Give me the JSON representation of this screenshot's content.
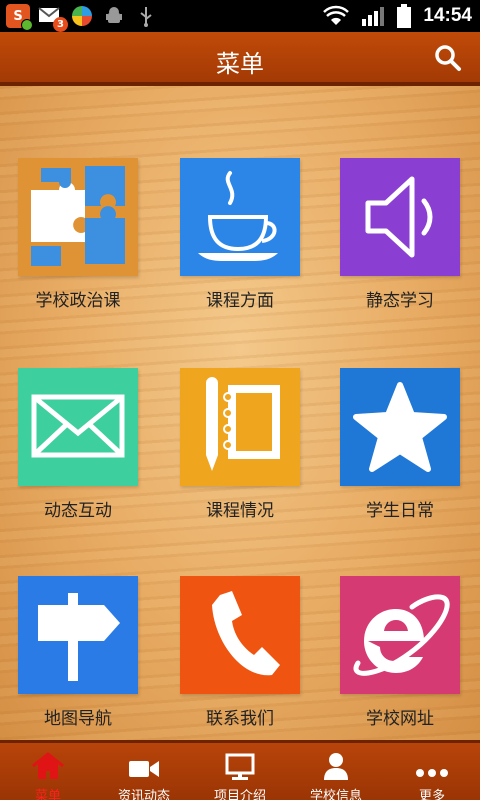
{
  "status_bar": {
    "time": "14:54",
    "badge_count": "3",
    "app_s_letter": "S"
  },
  "header": {
    "title": "菜单"
  },
  "tiles": [
    {
      "label": "学校政治课",
      "color": "#e09334",
      "icon": "puzzle-icon"
    },
    {
      "label": "课程方面",
      "color": "#2b86e8",
      "icon": "coffee-cup-icon"
    },
    {
      "label": "静态学习",
      "color": "#8b3fd2",
      "icon": "speaker-icon"
    },
    {
      "label": "动态互动",
      "color": "#3ecf9f",
      "icon": "envelope-icon"
    },
    {
      "label": "课程情况",
      "color": "#f0a51e",
      "icon": "notebook-pen-icon"
    },
    {
      "label": "学生日常",
      "color": "#1f78d6",
      "icon": "star-icon"
    },
    {
      "label": "地图导航",
      "color": "#2b7be6",
      "icon": "signpost-icon"
    },
    {
      "label": "联系我们",
      "color": "#ef5411",
      "icon": "phone-icon"
    },
    {
      "label": "学校网址",
      "color": "#d63a73",
      "icon": "internet-explorer-icon"
    }
  ],
  "bottom_nav": [
    {
      "label": "菜单",
      "icon": "home-icon",
      "active": true
    },
    {
      "label": "资讯动态",
      "icon": "video-camera-icon"
    },
    {
      "label": "项目介绍",
      "icon": "monitor-icon"
    },
    {
      "label": "学校信息",
      "icon": "person-icon"
    },
    {
      "label": "更多",
      "icon": "more-dots-icon"
    }
  ]
}
